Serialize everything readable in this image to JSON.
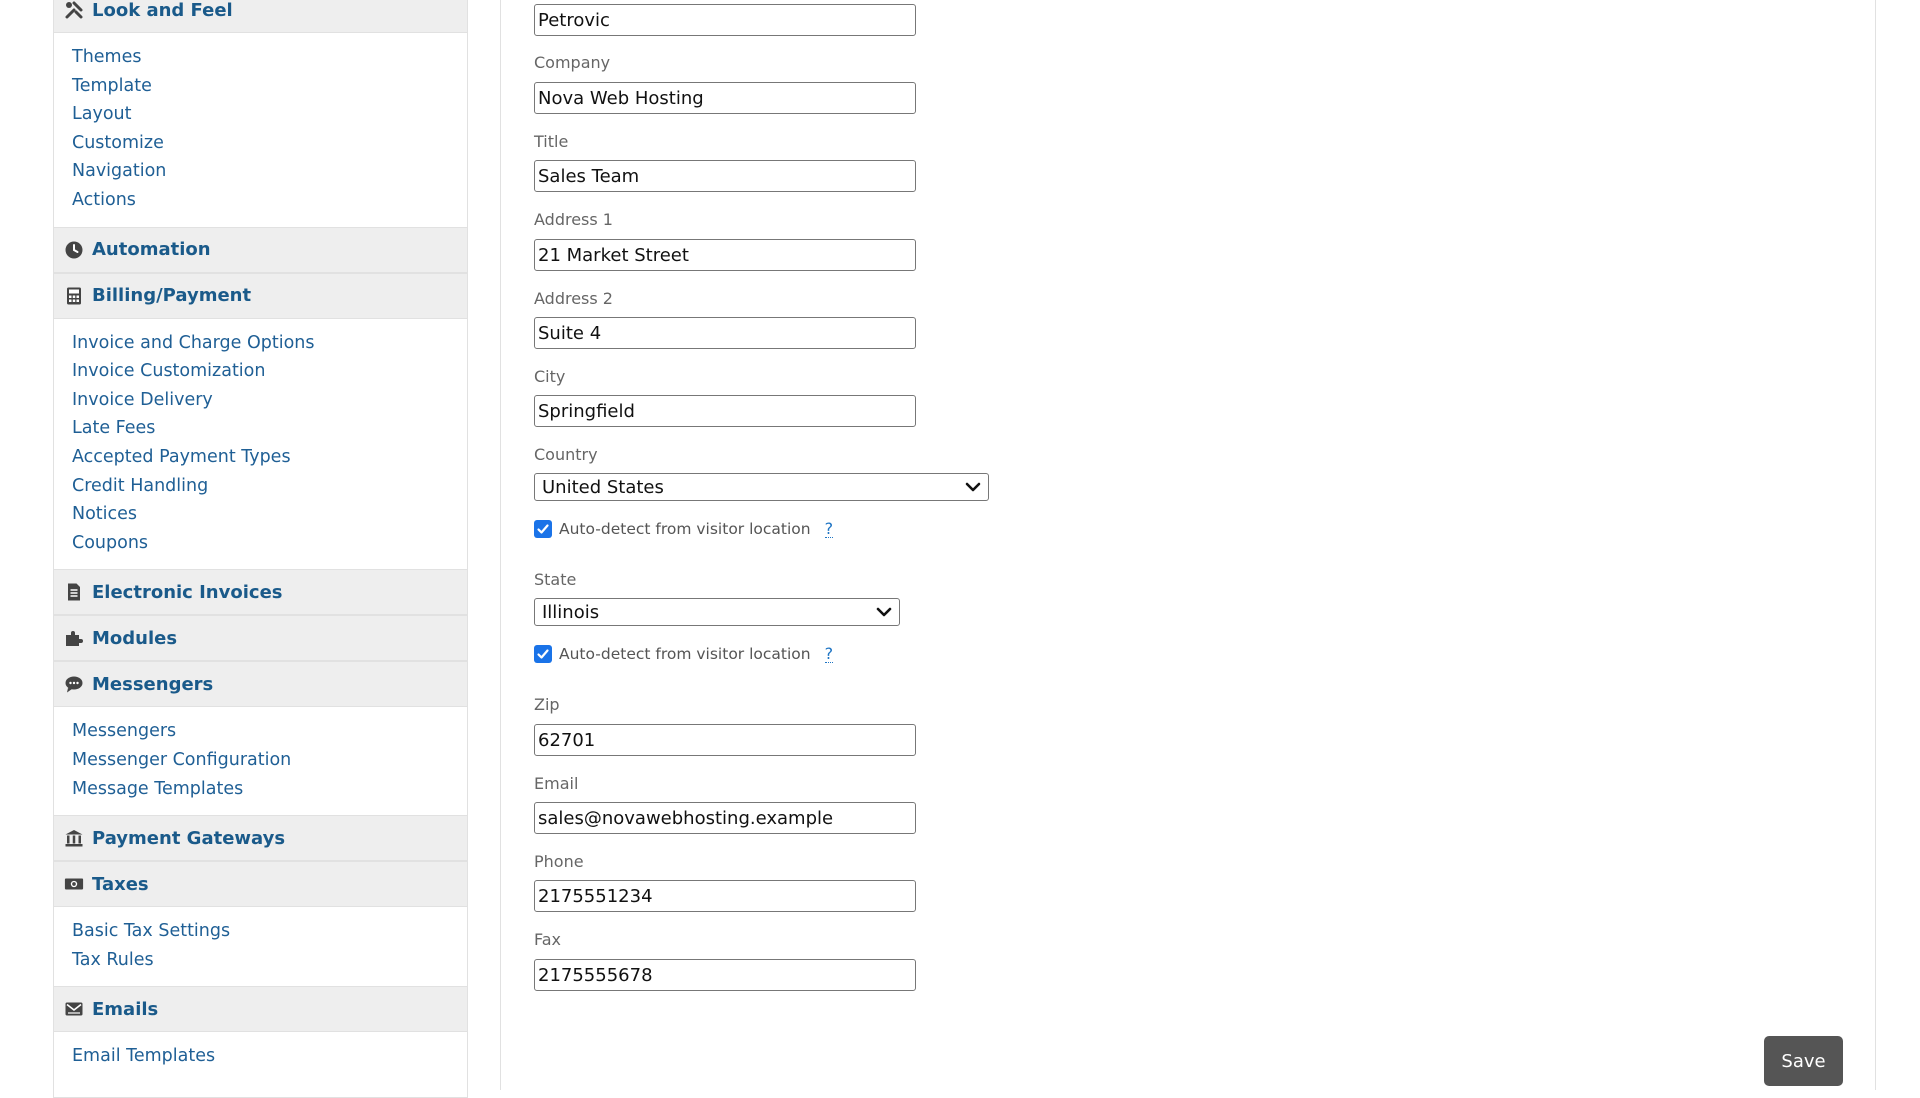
{
  "sidebar": {
    "sections": [
      {
        "title": "Look and Feel",
        "icon": "tools-icon",
        "items": [
          "Themes",
          "Template",
          "Layout",
          "Customize",
          "Navigation",
          "Actions"
        ]
      },
      {
        "title": "Automation",
        "icon": "clock-icon",
        "items": []
      },
      {
        "title": "Billing/Payment",
        "icon": "calculator-icon",
        "items": [
          "Invoice and Charge Options",
          "Invoice Customization",
          "Invoice Delivery",
          "Late Fees",
          "Accepted Payment Types",
          "Credit Handling",
          "Notices",
          "Coupons"
        ]
      },
      {
        "title": "Electronic Invoices",
        "icon": "document-icon",
        "items": []
      },
      {
        "title": "Modules",
        "icon": "puzzle-icon",
        "items": []
      },
      {
        "title": "Messengers",
        "icon": "chat-icon",
        "items": [
          "Messengers",
          "Messenger Configuration",
          "Message Templates"
        ]
      },
      {
        "title": "Payment Gateways",
        "icon": "bank-icon",
        "items": []
      },
      {
        "title": "Taxes",
        "icon": "money-icon",
        "items": [
          "Basic Tax Settings",
          "Tax Rules"
        ]
      },
      {
        "title": "Emails",
        "icon": "envelope-icon",
        "items": [
          "Email Templates"
        ]
      }
    ]
  },
  "form": {
    "last_name_value": "Petrovic",
    "company_label": "Company",
    "company_value": "Nova Web Hosting",
    "title_label": "Title",
    "title_value": "Sales Team",
    "address1_label": "Address 1",
    "address1_value": "21 Market Street",
    "address2_label": "Address 2",
    "address2_value": "Suite 4",
    "city_label": "City",
    "city_value": "Springfield",
    "country_label": "Country",
    "country_value": "United States",
    "autodetect_label": "Auto-detect from visitor location",
    "help_mark": "?",
    "state_label": "State",
    "state_value": "Illinois",
    "zip_label": "Zip",
    "zip_value": "62701",
    "email_label": "Email",
    "email_value": "sales@novawebhosting.example",
    "phone_label": "Phone",
    "phone_value": "2175551234",
    "fax_label": "Fax",
    "fax_value": "2175555678",
    "save_label": "Save"
  },
  "colors": {
    "link": "#1f5f95",
    "header_link": "#1a5a8a",
    "checkbox": "#1a73e8",
    "save_button": "#555555"
  }
}
